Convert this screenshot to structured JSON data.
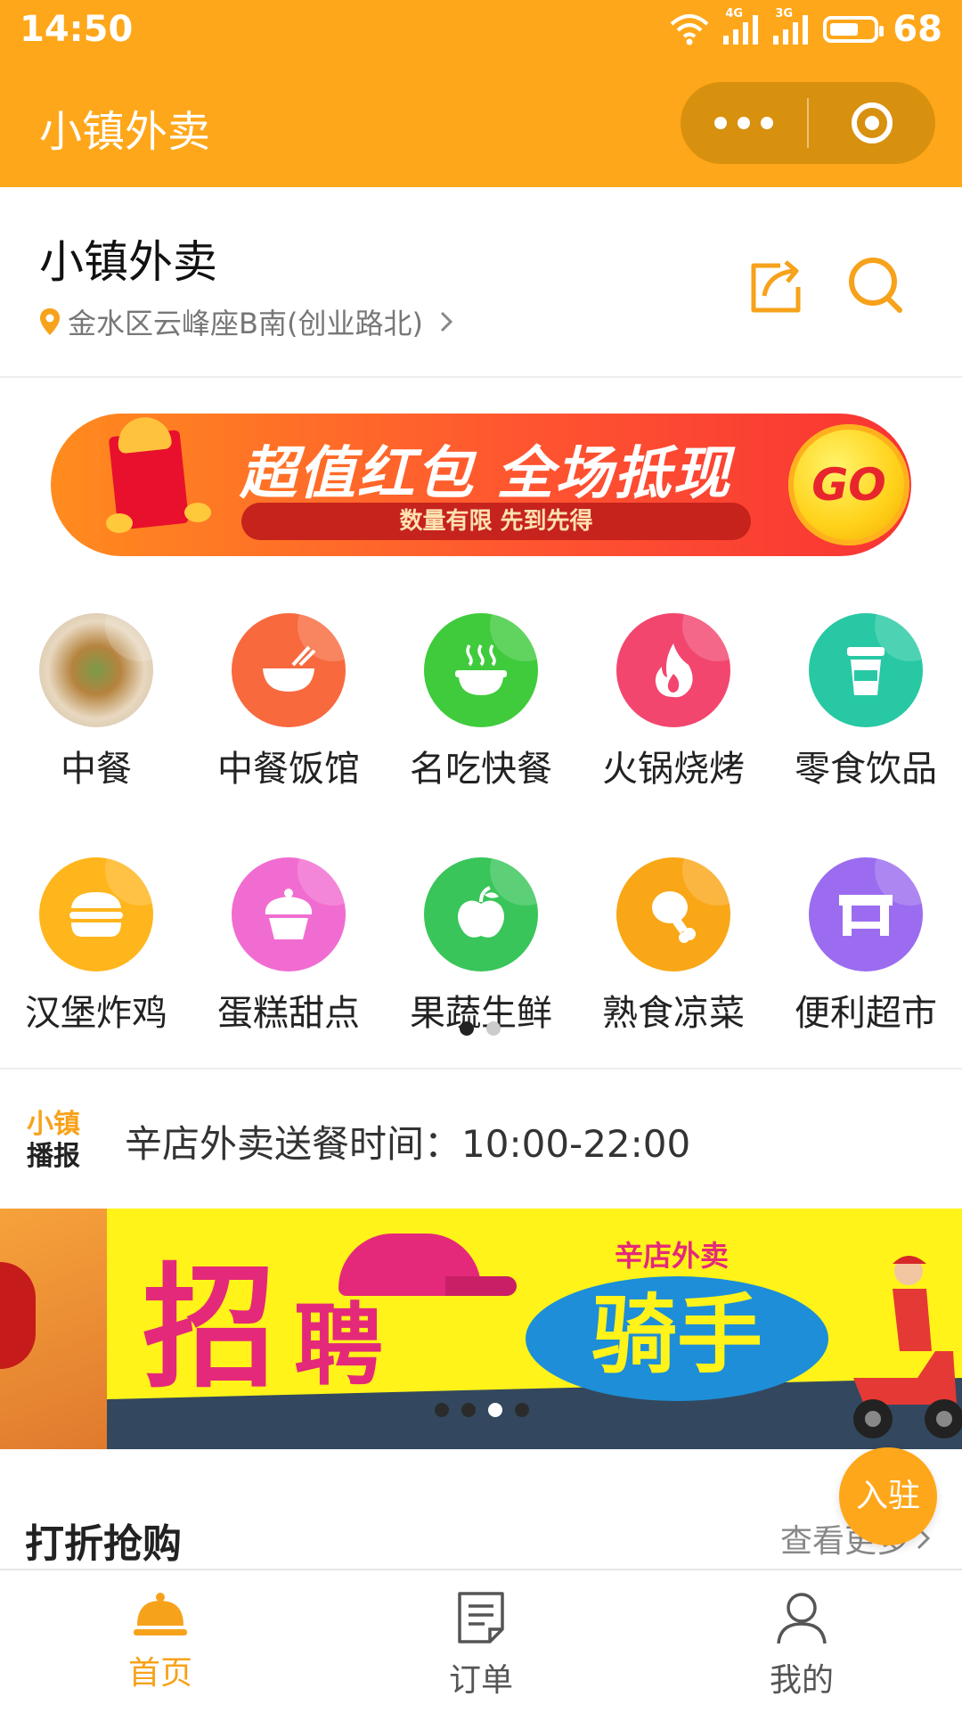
{
  "status_bar": {
    "time": "14:50",
    "network_1": "4G",
    "network_2": "3G",
    "battery": "68",
    "battery_level": 0.68
  },
  "titlebar": {
    "title": "小镇外卖"
  },
  "header": {
    "store_name": "小镇外卖",
    "address": "金水区云峰座B南(创业路北)"
  },
  "promo_banner": {
    "headline": "超值红包 全场抵现",
    "subline": "数量有限 先到先得",
    "go_label": "GO"
  },
  "categories": [
    {
      "label": "中餐",
      "icon": "chinese-dish-photo-icon",
      "color": "#D9C7A8"
    },
    {
      "label": "中餐饭馆",
      "icon": "rice-bowl-icon",
      "color": "#F8693E"
    },
    {
      "label": "名吃快餐",
      "icon": "steaming-bowl-icon",
      "color": "#3FCB3C"
    },
    {
      "label": "火锅烧烤",
      "icon": "flame-icon",
      "color": "#F2466E"
    },
    {
      "label": "零食饮品",
      "icon": "drink-cup-icon",
      "color": "#28C8A4"
    },
    {
      "label": "汉堡炸鸡",
      "icon": "burger-icon",
      "color": "#FFB51C"
    },
    {
      "label": "蛋糕甜点",
      "icon": "cupcake-icon",
      "color": "#F16CD0"
    },
    {
      "label": "果蔬生鲜",
      "icon": "apple-icon",
      "color": "#39C55A"
    },
    {
      "label": "熟食凉菜",
      "icon": "drumstick-icon",
      "color": "#F9A716"
    },
    {
      "label": "便利超市",
      "icon": "store-counter-icon",
      "color": "#9B6CF0"
    }
  ],
  "category_pager": {
    "pages": 2,
    "current": 1
  },
  "notice": {
    "logo_line1": "小镇",
    "logo_line2": "播报",
    "text": "辛店外卖送餐时间：10:00-22:00"
  },
  "recruit_banner": {
    "char_zhao": "招",
    "char_pin": "聘",
    "brand": "辛店外卖",
    "role": "骑手",
    "pages": 4,
    "current": 3
  },
  "discount": {
    "title": "打折抢购",
    "more_label": "查看更多"
  },
  "join_button": {
    "label": "入驻"
  },
  "tabbar": {
    "tabs": [
      {
        "label": "首页",
        "icon": "home-cloche-icon",
        "active": true
      },
      {
        "label": "订单",
        "icon": "order-list-icon",
        "active": false
      },
      {
        "label": "我的",
        "icon": "user-profile-icon",
        "active": false
      }
    ]
  },
  "colors": {
    "brand": "#FFA71A",
    "active_tab": "#F7A21B"
  }
}
